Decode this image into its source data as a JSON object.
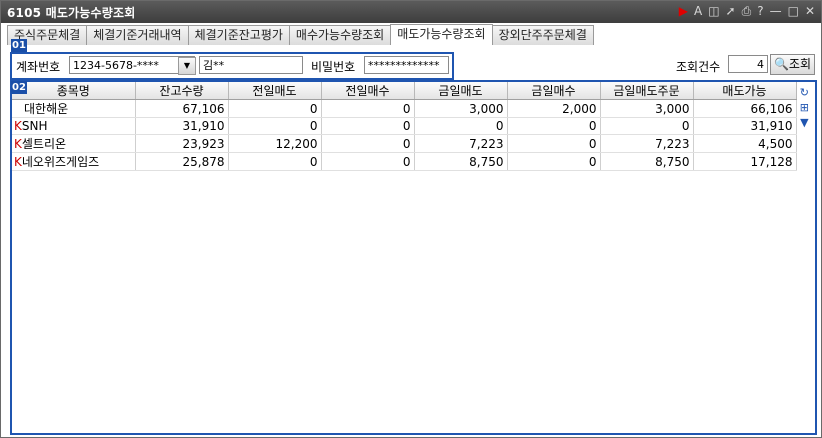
{
  "window": {
    "title": "6105 매도가능수량조회",
    "title_icons": [
      "play-icon",
      "font-icon",
      "window-icon",
      "pin-icon",
      "print-icon",
      "help-icon",
      "minimize-icon",
      "maximize-icon",
      "close-icon"
    ],
    "title_icon_glyphs": [
      "▶",
      "A",
      "◫",
      "➚",
      "⎙",
      "?",
      "—",
      "□",
      "✕"
    ]
  },
  "tabs": [
    {
      "label": "주식주문체결",
      "active": false
    },
    {
      "label": "체결기준거래내역",
      "active": false
    },
    {
      "label": "체결기준잔고평가",
      "active": false
    },
    {
      "label": "매수가능수량조회",
      "active": false
    },
    {
      "label": "매도가능수량조회",
      "active": true
    },
    {
      "label": "장외단주주문체결",
      "active": false
    }
  ],
  "badges": {
    "first": "01",
    "second": "02"
  },
  "account": {
    "label": "계좌번호",
    "number": "1234-5678-****",
    "name": "김**",
    "password_label": "비밀번호",
    "password": "*************"
  },
  "query": {
    "count_label": "조회건수",
    "count": "4",
    "button_label": "조회"
  },
  "table": {
    "headers": [
      "종목명",
      "잔고수량",
      "전일매도",
      "전일매수",
      "금일매도",
      "금일매수",
      "금일매도주문",
      "매도가능"
    ],
    "rows": [
      {
        "prefix": "",
        "name": "대한해운",
        "cells": [
          "67,106",
          "0",
          "0",
          "3,000",
          "2,000",
          "3,000",
          "66,106"
        ]
      },
      {
        "prefix": "K",
        "name": "SNH",
        "cells": [
          "31,910",
          "0",
          "0",
          "0",
          "0",
          "0",
          "31,910"
        ]
      },
      {
        "prefix": "K",
        "name": "셀트리온",
        "cells": [
          "23,923",
          "12,200",
          "0",
          "7,223",
          "0",
          "7,223",
          "4,500"
        ]
      },
      {
        "prefix": "K",
        "name": "네오위즈게임즈",
        "cells": [
          "25,878",
          "0",
          "0",
          "8,750",
          "0",
          "8,750",
          "17,128"
        ]
      }
    ]
  },
  "colors": {
    "accent": "#1f55b0",
    "titlebar": "#4a4a4a",
    "market_mark": "#cc0000"
  }
}
